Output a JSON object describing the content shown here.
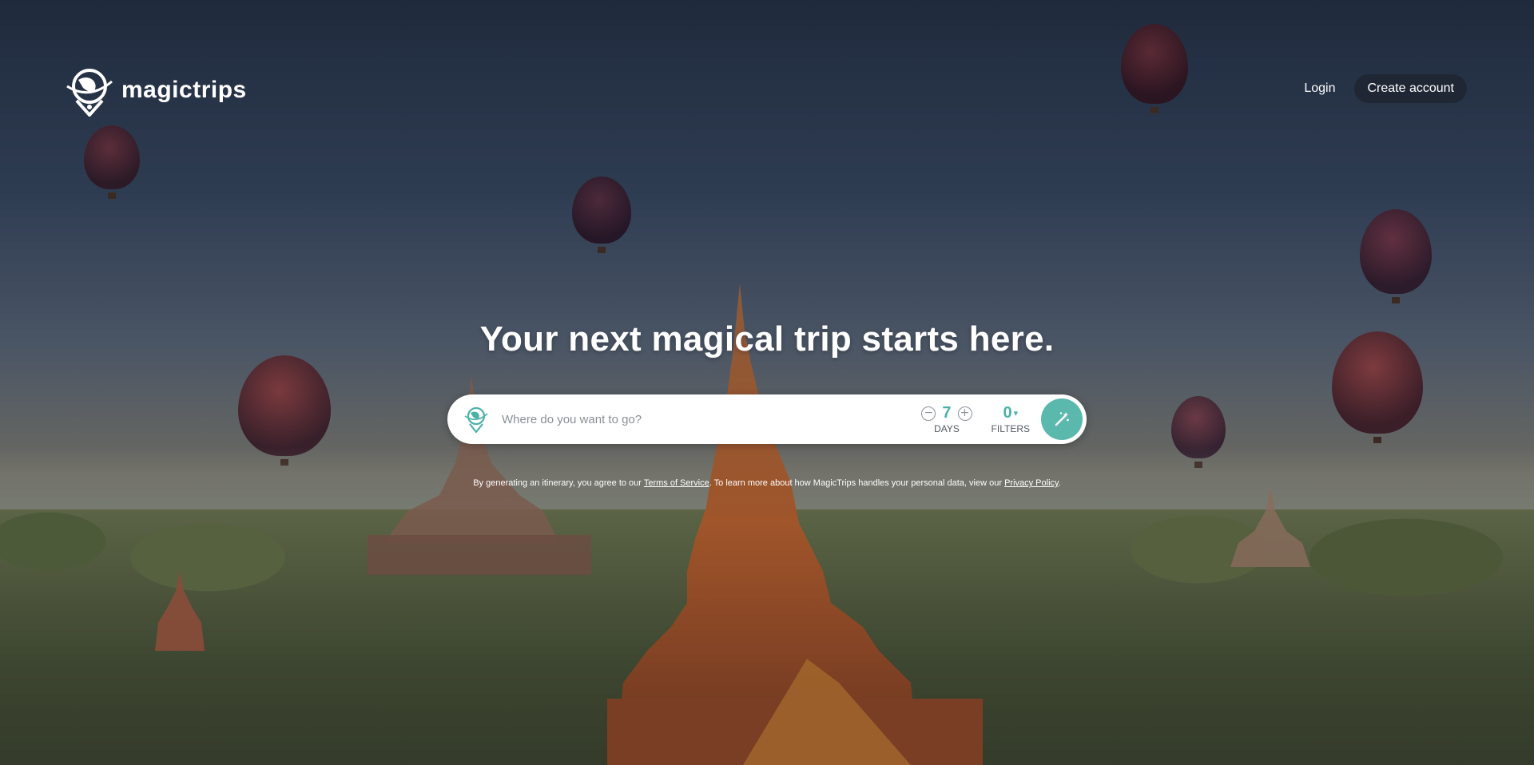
{
  "brand": {
    "name": "magictrips",
    "logo_icon": "globe-pin-icon"
  },
  "nav": {
    "login_label": "Login",
    "create_account_label": "Create account"
  },
  "hero": {
    "title": "Your next magical trip starts here."
  },
  "search": {
    "placeholder": "Where do you want to go?",
    "pin_icon": "globe-pin-icon",
    "days_value": "7",
    "days_label": "DAYS",
    "decrement_icon": "minus-circle-icon",
    "increment_icon": "plus-circle-icon",
    "filters_value": "0",
    "filters_label": "FILTERS",
    "filters_caret": "▾",
    "submit_icon": "magic-wand-icon"
  },
  "legal": {
    "prefix": "By generating an itinerary, you agree to our ",
    "terms_label": "Terms of Service",
    "middle": ". To learn more about how MagicTrips handles your personal data, view our ",
    "privacy_label": "Privacy Policy",
    "suffix": "."
  },
  "colors": {
    "accent": "#5bb8ad",
    "accent_text": "#4cb1a8",
    "button_dark": "#1f2734"
  }
}
